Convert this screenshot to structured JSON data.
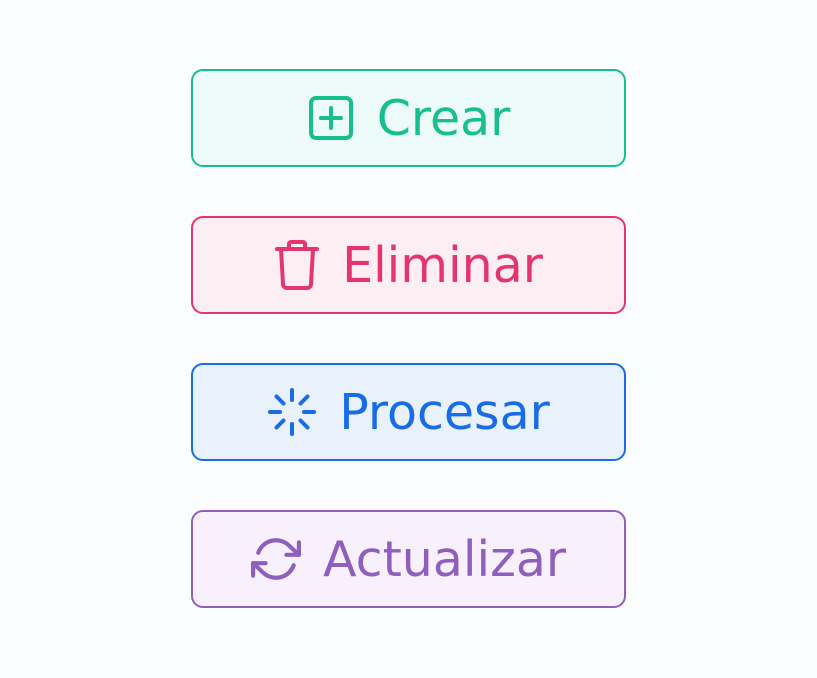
{
  "buttons": {
    "create": {
      "label": "Crear",
      "icon": "plus-square-icon",
      "color": "#15bf8e"
    },
    "delete": {
      "label": "Eliminar",
      "icon": "trash-icon",
      "color": "#e53570"
    },
    "process": {
      "label": "Procesar",
      "icon": "loader-icon",
      "color": "#1a6ce6"
    },
    "refresh": {
      "label": "Actualizar",
      "icon": "refresh-icon",
      "color": "#8f5fbd"
    }
  }
}
